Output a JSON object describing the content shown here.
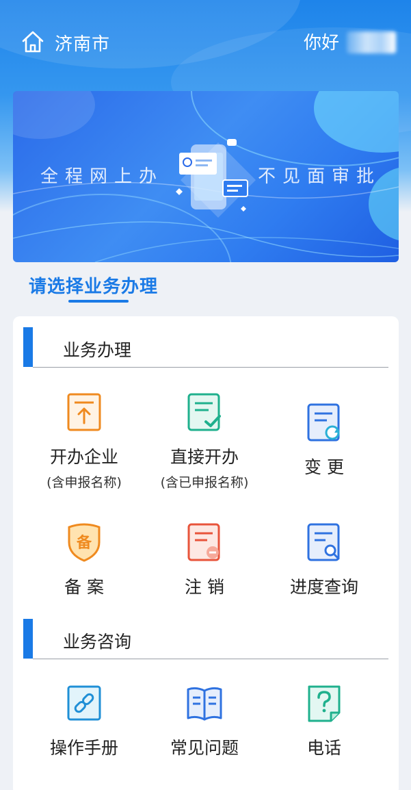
{
  "header": {
    "city": "济南市",
    "greeting": "你好"
  },
  "banner": {
    "left_text": "全程网上办",
    "right_text": "不见面审批"
  },
  "section_title": "请选择业务办理",
  "groups": [
    {
      "title": "业务办理",
      "items": [
        {
          "label": "开办企业",
          "sub": "(含申报名称)",
          "icon": "upload-doc-icon"
        },
        {
          "label": "直接开办",
          "sub": "(含已申报名称)",
          "icon": "checked-doc-icon"
        },
        {
          "label": "变 更",
          "sub": "",
          "icon": "refresh-doc-icon"
        },
        {
          "label": "备 案",
          "sub": "",
          "icon": "filing-badge-icon"
        },
        {
          "label": "注 销",
          "sub": "",
          "icon": "minus-doc-icon"
        },
        {
          "label": "进度查询",
          "sub": "",
          "icon": "search-doc-icon"
        }
      ]
    },
    {
      "title": "业务咨询",
      "items": [
        {
          "label": "操作手册",
          "icon": "link-manual-icon"
        },
        {
          "label": "常见问题",
          "icon": "open-book-icon"
        },
        {
          "label": "电话",
          "icon": "question-phone-icon"
        }
      ]
    }
  ],
  "banner_badge_char": "备",
  "colors": {
    "accent": "#1a7ae6",
    "orange": "#ef8a1f",
    "green": "#1fb08d",
    "blue": "#2f72e0",
    "red": "#e8543b",
    "teal": "#21a6b8"
  }
}
